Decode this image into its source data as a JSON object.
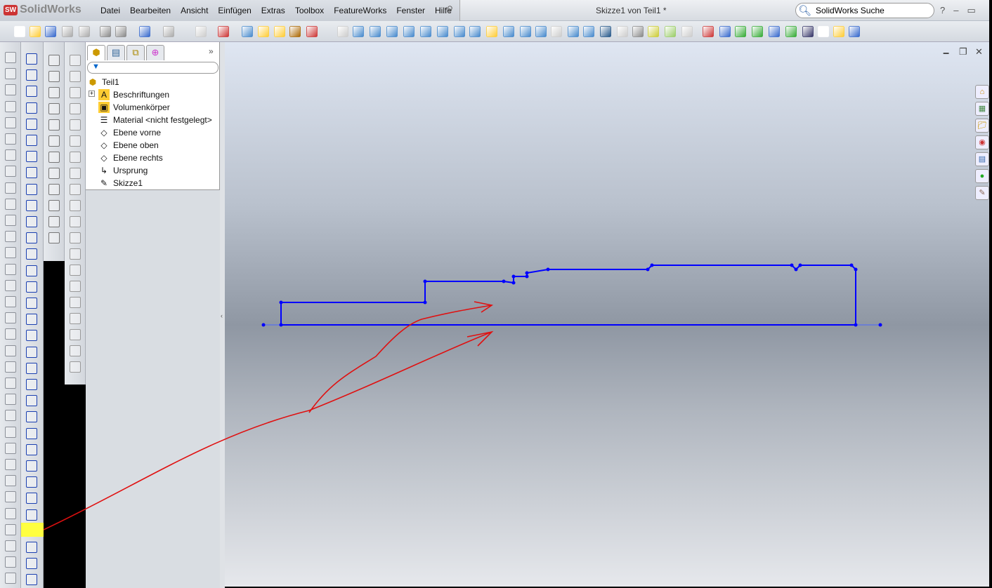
{
  "app": {
    "logo": "SolidWorks",
    "logo_badge": "SW",
    "document_title": "Skizze1 von Teil1 *"
  },
  "menu": [
    "Datei",
    "Bearbeiten",
    "Ansicht",
    "Einfügen",
    "Extras",
    "Toolbox",
    "FeatureWorks",
    "Fenster",
    "Hilfe"
  ],
  "search": {
    "placeholder": "SolidWorks Suche"
  },
  "window_buttons": {
    "help": "?",
    "minimize": "–",
    "restore": "▭",
    "close": "✕"
  },
  "feature_tree": {
    "tabs": [
      "feature-manager",
      "property-manager",
      "configuration-manager",
      "dimxpert-manager"
    ],
    "expand": "»",
    "filter_icon": "filter-icon",
    "root": "Teil1",
    "nodes": [
      {
        "label": "Beschriftungen",
        "icon": "annotations-folder-icon",
        "glyph": "A"
      },
      {
        "label": "Volumenkörper",
        "icon": "solid-bodies-folder-icon",
        "glyph": "▣"
      },
      {
        "label": "Material <nicht festgelegt>",
        "icon": "material-icon",
        "glyph": "☰"
      },
      {
        "label": "Ebene vorne",
        "icon": "plane-icon",
        "glyph": "◇"
      },
      {
        "label": "Ebene oben",
        "icon": "plane-icon",
        "glyph": "◇"
      },
      {
        "label": "Ebene rechts",
        "icon": "plane-icon",
        "glyph": "◇"
      },
      {
        "label": "Ursprung",
        "icon": "origin-icon",
        "glyph": "↳"
      },
      {
        "label": "Skizze1",
        "icon": "sketch-icon",
        "glyph": "✎"
      }
    ]
  },
  "colors": {
    "sketch": "#0000ff",
    "annotation": "#e01010",
    "highlight": "#ffff40"
  }
}
